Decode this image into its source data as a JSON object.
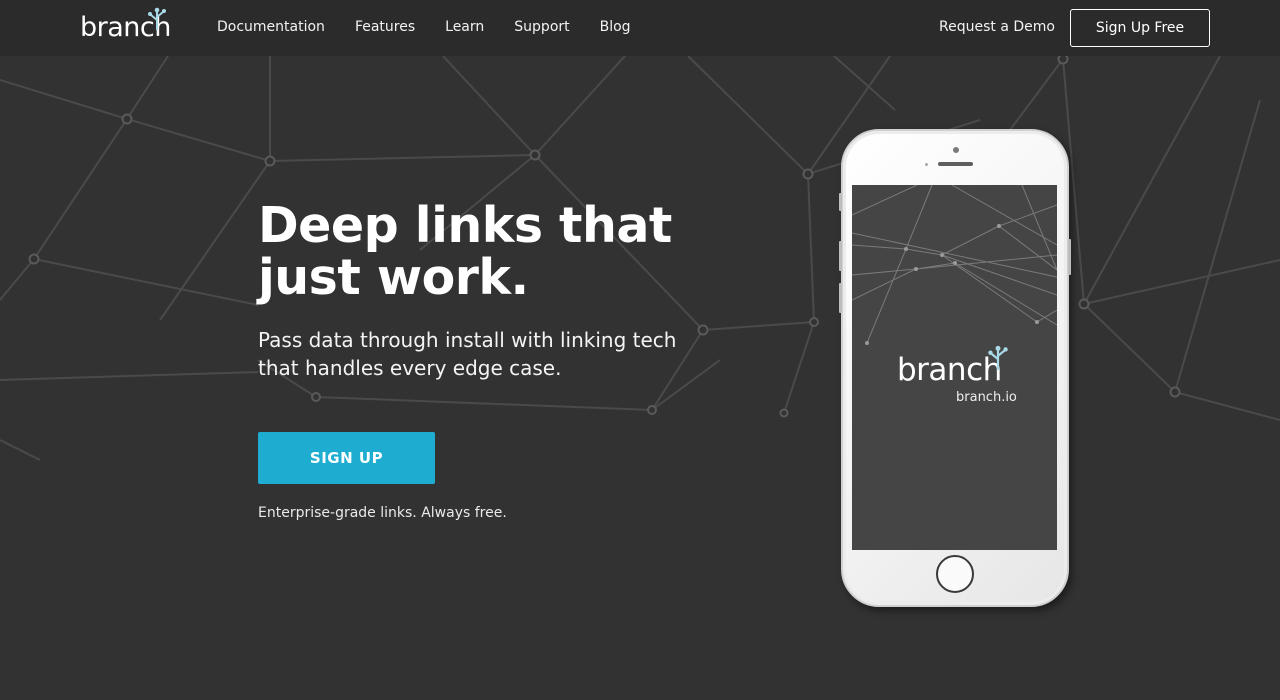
{
  "brand": {
    "logo_text": "branch",
    "logo_icon": "sprout-icon"
  },
  "nav": {
    "items": [
      "Documentation",
      "Features",
      "Learn",
      "Support",
      "Blog"
    ],
    "request_demo": "Request a Demo",
    "signup_free": "Sign Up Free"
  },
  "hero": {
    "title": "Deep links that just work.",
    "subtitle": "Pass data through install with linking tech that handles every edge case.",
    "cta_label": "SIGN UP",
    "cta_note": "Enterprise-grade links. Always free."
  },
  "phone": {
    "screen_logo": "branch",
    "screen_url": "branch.io"
  },
  "colors": {
    "background": "#323232",
    "header": "#2b2b2b",
    "accent": "#1eadd0",
    "phone_screen": "#454545"
  }
}
